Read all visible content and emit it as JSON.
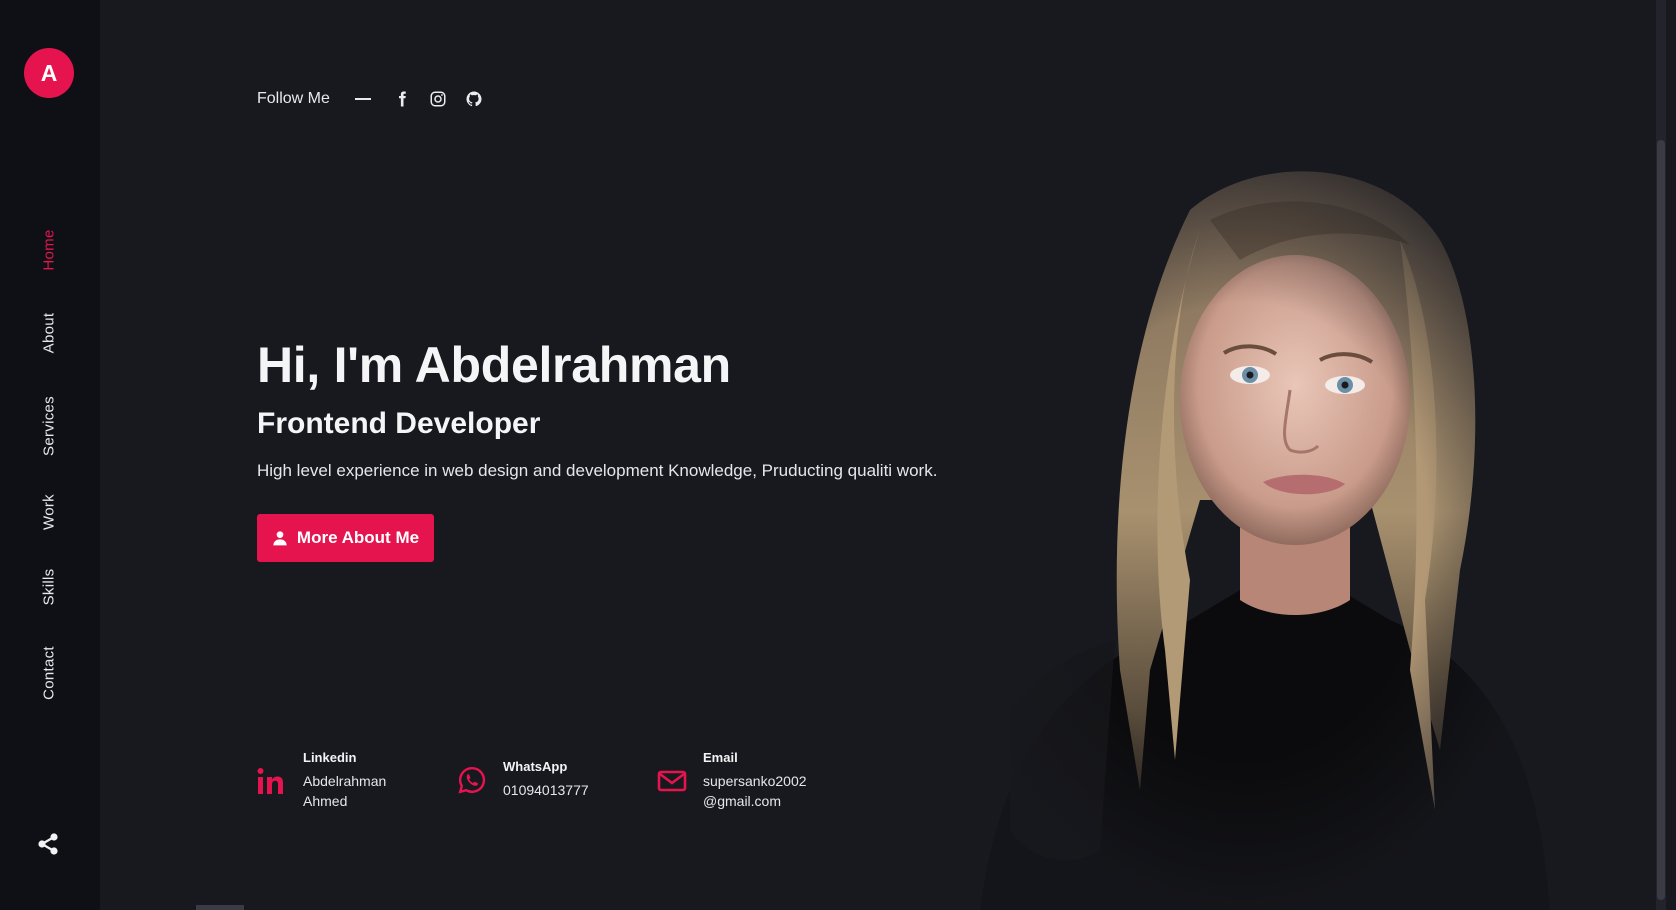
{
  "sidebar": {
    "logo_letter": "A",
    "nav": [
      {
        "label": "Home",
        "active": true
      },
      {
        "label": "About",
        "active": false
      },
      {
        "label": "Services",
        "active": false
      },
      {
        "label": "Work",
        "active": false
      },
      {
        "label": "Skills",
        "active": false
      },
      {
        "label": "Contact",
        "active": false
      }
    ],
    "share_icon": "share-icon"
  },
  "hero": {
    "follow_label": "Follow Me",
    "social_icons": [
      "facebook-icon",
      "instagram-icon",
      "github-icon"
    ],
    "title": "Hi, I'm Abdelrahman",
    "subtitle": "Frontend Developer",
    "description": "High level experience in web design and development Knowledge, Pruducting qualiti work.",
    "cta_label": "More About Me",
    "cta_icon": "user-icon"
  },
  "contacts": [
    {
      "title": "Linkedin",
      "value": "Abdelrahman\nAhmed",
      "icon": "linkedin-icon"
    },
    {
      "title": "WhatsApp",
      "value": "01094013777",
      "icon": "whatsapp-icon"
    },
    {
      "title": "Email",
      "value": "supersanko2002\n@gmail.com",
      "icon": "mail-icon"
    }
  ],
  "colors": {
    "accent": "#e5144f",
    "background": "#18191f",
    "sidebar": "#0f1015"
  }
}
